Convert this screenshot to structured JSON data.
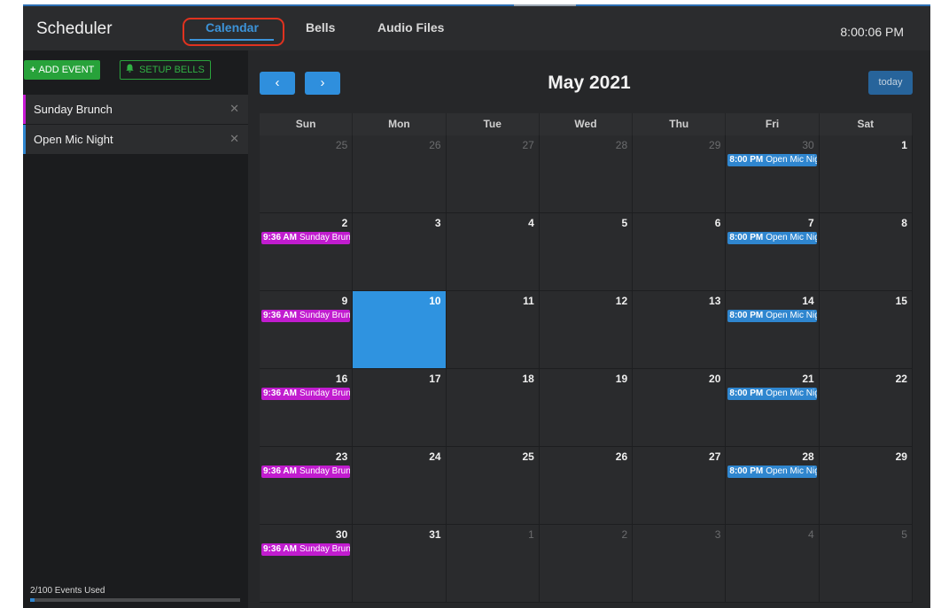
{
  "app": {
    "title": "Scheduler",
    "clock": "8:00:06 PM",
    "nav": {
      "calendar": "Calendar",
      "bells": "Bells",
      "audio_files": "Audio Files"
    }
  },
  "sidebar": {
    "add_event": "ADD EVENT",
    "setup_bells": "SETUP BELLS",
    "events": [
      {
        "name": "Sunday Brunch",
        "color": "#c71ad4"
      },
      {
        "name": "Open Mic Night",
        "color": "#2f86cf"
      }
    ],
    "usage": {
      "text": "2/100 Events Used",
      "used": 2,
      "total": 100
    }
  },
  "calendar": {
    "month_title": "May 2021",
    "today_label": "today",
    "prev_icon": "‹",
    "next_icon": "›",
    "weekdays": [
      "Sun",
      "Mon",
      "Tue",
      "Wed",
      "Thu",
      "Fri",
      "Sat"
    ],
    "event_labels": {
      "brunch": {
        "time": "9:36 AM",
        "title": "Sunday Brunch",
        "color": "#c11ccf"
      },
      "mic": {
        "time": "8:00 PM",
        "title": "Open Mic Night",
        "color": "#2f86cf"
      }
    },
    "weeks": [
      [
        {
          "day": "25",
          "other": true
        },
        {
          "day": "26",
          "other": true
        },
        {
          "day": "27",
          "other": true
        },
        {
          "day": "28",
          "other": true
        },
        {
          "day": "29",
          "other": true
        },
        {
          "day": "30",
          "other": true,
          "event": "mic"
        },
        {
          "day": "1"
        }
      ],
      [
        {
          "day": "2",
          "event": "brunch"
        },
        {
          "day": "3"
        },
        {
          "day": "4"
        },
        {
          "day": "5"
        },
        {
          "day": "6"
        },
        {
          "day": "7",
          "event": "mic"
        },
        {
          "day": "8"
        }
      ],
      [
        {
          "day": "9",
          "event": "brunch"
        },
        {
          "day": "10",
          "today": true
        },
        {
          "day": "11"
        },
        {
          "day": "12"
        },
        {
          "day": "13"
        },
        {
          "day": "14",
          "event": "mic"
        },
        {
          "day": "15"
        }
      ],
      [
        {
          "day": "16",
          "event": "brunch"
        },
        {
          "day": "17"
        },
        {
          "day": "18"
        },
        {
          "day": "19"
        },
        {
          "day": "20"
        },
        {
          "day": "21",
          "event": "mic"
        },
        {
          "day": "22"
        }
      ],
      [
        {
          "day": "23",
          "event": "brunch"
        },
        {
          "day": "24"
        },
        {
          "day": "25"
        },
        {
          "day": "26"
        },
        {
          "day": "27"
        },
        {
          "day": "28",
          "event": "mic"
        },
        {
          "day": "29"
        }
      ],
      [
        {
          "day": "30",
          "event": "brunch"
        },
        {
          "day": "31"
        },
        {
          "day": "1",
          "other": true
        },
        {
          "day": "2",
          "other": true
        },
        {
          "day": "3",
          "other": true
        },
        {
          "day": "4",
          "other": true
        },
        {
          "day": "5",
          "other": true
        }
      ]
    ]
  }
}
